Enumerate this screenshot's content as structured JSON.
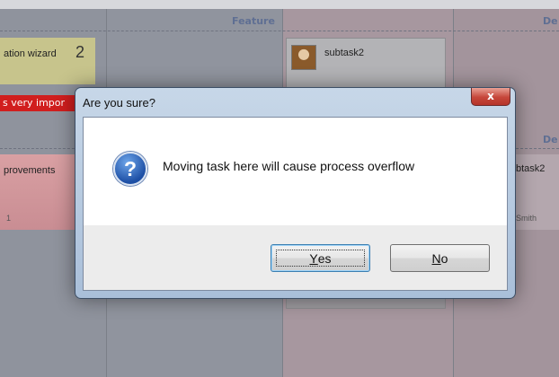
{
  "board": {
    "columns": [
      "Feature",
      "De",
      "De"
    ],
    "cards": {
      "wizard_title": "ation wizard",
      "wizard_count": "2",
      "important_label": "s very impor",
      "improvements_title": "provements",
      "improvements_count": "1",
      "subtask_top": "subtask2",
      "subtask_right": "btask2",
      "assignee_right": "Smith"
    }
  },
  "dialog": {
    "title": "Are you sure?",
    "close_label": "x",
    "icon": "question-icon",
    "icon_glyph": "?",
    "message": "Moving task here will cause process overflow",
    "yes_mnemonic": "Y",
    "yes_rest": "es",
    "no_mnemonic": "N",
    "no_rest": "o"
  },
  "colors": {
    "accent": "#1d4fa5",
    "close": "#c6463a",
    "important": "#d11e1e"
  }
}
